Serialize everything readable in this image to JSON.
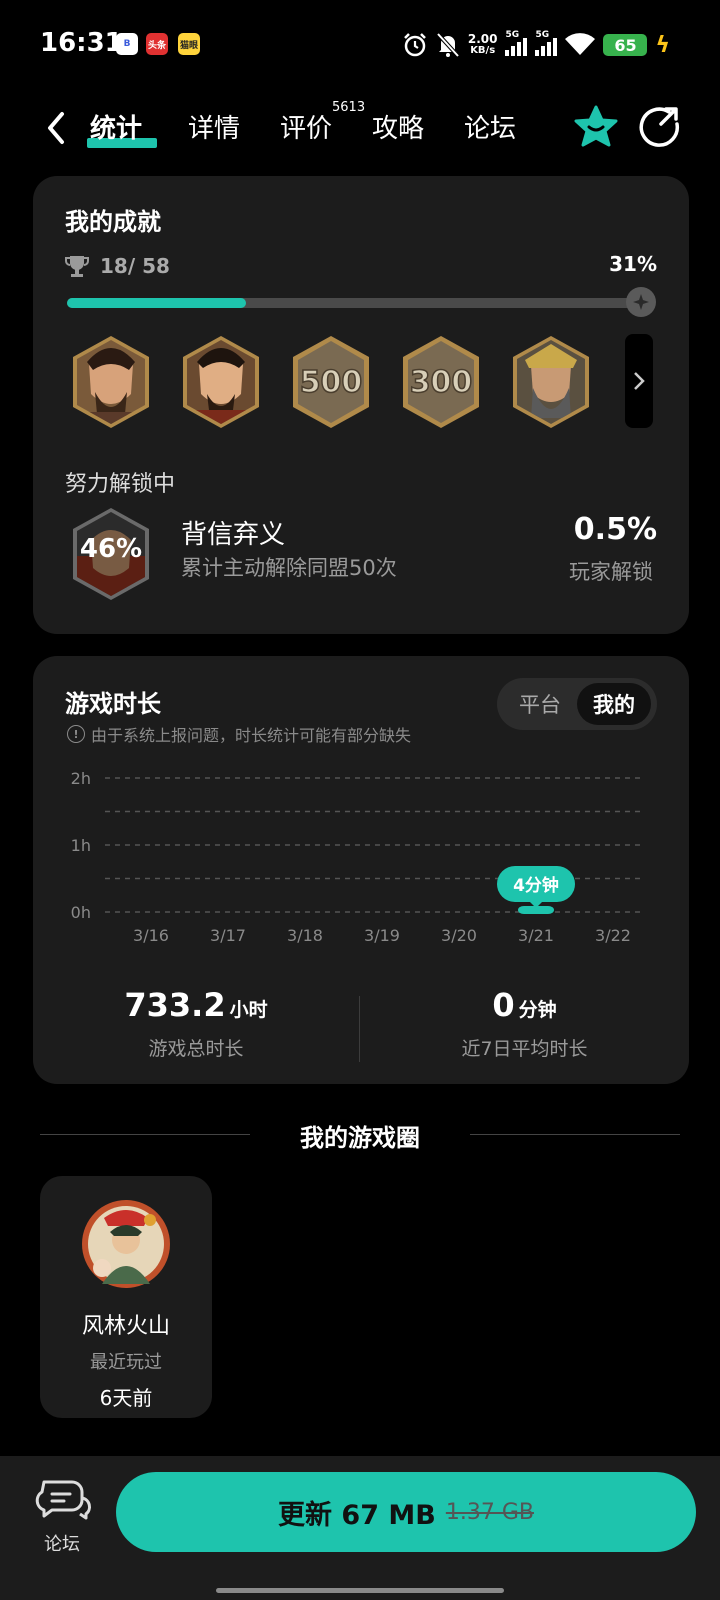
{
  "status_bar": {
    "time": "16:31",
    "app_icons": [
      "B",
      "头条",
      "猫眼"
    ],
    "net_speed_value": "2.00",
    "net_speed_unit": "KB/s",
    "signal1": "5G",
    "signal2": "5G",
    "battery": "65"
  },
  "nav": {
    "tabs": [
      {
        "label": "统计",
        "active": true
      },
      {
        "label": "详情",
        "active": false
      },
      {
        "label": "评价",
        "active": false
      },
      {
        "label": "攻略",
        "active": false
      },
      {
        "label": "论坛",
        "active": false
      }
    ],
    "review_count": "5613"
  },
  "achievements": {
    "title": "我的成就",
    "count": "18/ 58",
    "percent": "31%",
    "progress": 0.31,
    "badges": [
      "portrait-1",
      "portrait-2",
      "500",
      "300",
      "portrait-3"
    ],
    "unlocking_label": "努力解锁中",
    "current": {
      "progress": "46%",
      "name": "背信弃义",
      "desc": "累计主动解除同盟50次",
      "rate": "0.5%",
      "rate_label": "玩家解锁"
    }
  },
  "playtime": {
    "title": "游戏时长",
    "notice": "由于系统上报问题，时长统计可能有部分缺失",
    "toggle": {
      "off": "平台",
      "on": "我的"
    },
    "tooltip": "4分钟",
    "total_value": "733.2",
    "total_unit": "小时",
    "total_label": "游戏总时长",
    "avg_value": "0",
    "avg_unit": "分钟",
    "avg_label": "近7日平均时长"
  },
  "chart_data": {
    "type": "bar",
    "categories": [
      "3/16",
      "3/17",
      "3/18",
      "3/19",
      "3/20",
      "3/21",
      "3/22"
    ],
    "values": [
      0,
      0,
      0,
      0,
      0,
      4,
      0
    ],
    "value_unit": "minutes",
    "y_ticks": [
      "0h",
      "1h",
      "2h"
    ],
    "ylim": [
      0,
      120
    ],
    "grid": true,
    "highlight_label": "4分钟"
  },
  "game_circle": {
    "title": "我的游戏圈",
    "name": "风林火山",
    "sub": "最近玩过",
    "time": "6天前"
  },
  "bottom": {
    "forum_label": "论坛",
    "update_label": "更新 67 MB",
    "old_size": "1.37 GB"
  },
  "colors": {
    "accent": "#1ec4ad",
    "card_bg": "#1c1c1c",
    "page_bg": "#000000"
  }
}
